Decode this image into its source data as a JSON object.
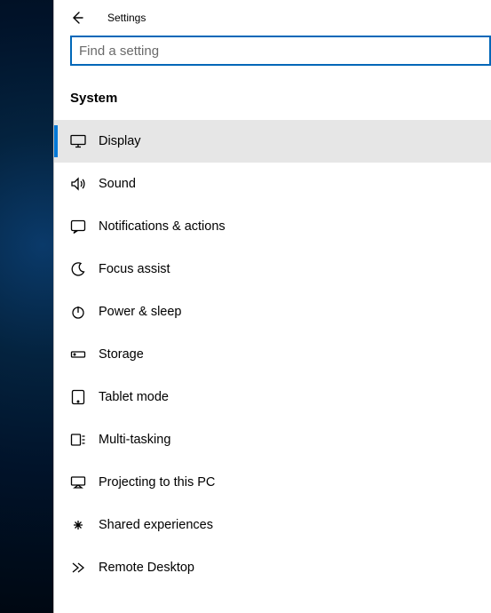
{
  "header": {
    "title": "Settings"
  },
  "search": {
    "placeholder": "Find a setting",
    "value": ""
  },
  "section": {
    "title": "System"
  },
  "nav": {
    "items": [
      {
        "label": "Display",
        "icon": "monitor-icon",
        "selected": true
      },
      {
        "label": "Sound",
        "icon": "sound-icon",
        "selected": false
      },
      {
        "label": "Notifications & actions",
        "icon": "notifications-icon",
        "selected": false
      },
      {
        "label": "Focus assist",
        "icon": "moon-icon",
        "selected": false
      },
      {
        "label": "Power & sleep",
        "icon": "power-icon",
        "selected": false
      },
      {
        "label": "Storage",
        "icon": "storage-icon",
        "selected": false
      },
      {
        "label": "Tablet mode",
        "icon": "tablet-icon",
        "selected": false
      },
      {
        "label": "Multi-tasking",
        "icon": "multitask-icon",
        "selected": false
      },
      {
        "label": "Projecting to this PC",
        "icon": "project-icon",
        "selected": false
      },
      {
        "label": "Shared experiences",
        "icon": "shared-icon",
        "selected": false
      },
      {
        "label": "Remote Desktop",
        "icon": "remote-icon",
        "selected": false
      }
    ]
  }
}
